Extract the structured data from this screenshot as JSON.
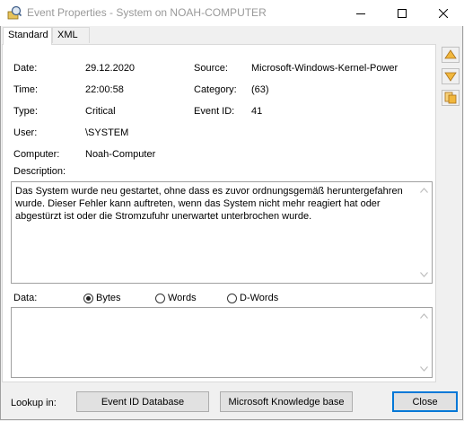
{
  "window": {
    "title": "Event Properties - System on NOAH-COMPUTER"
  },
  "tabs": [
    {
      "label": "Standard"
    },
    {
      "label": "XML"
    }
  ],
  "fields": {
    "date": {
      "label": "Date:",
      "value": "29.12.2020"
    },
    "time": {
      "label": "Time:",
      "value": "22:00:58"
    },
    "type": {
      "label": "Type:",
      "value": "Critical"
    },
    "user": {
      "label": "User:",
      "value": "\\SYSTEM"
    },
    "computer": {
      "label": "Computer:",
      "value": "Noah-Computer"
    },
    "source": {
      "label": "Source:",
      "value": "Microsoft-Windows-Kernel-Power"
    },
    "category": {
      "label": "Category:",
      "value": "(63)"
    },
    "event_id": {
      "label": "Event ID:",
      "value": "41"
    }
  },
  "description": {
    "label": "Description:",
    "text": "Das System wurde neu gestartet, ohne dass es zuvor ordnungsgemäß heruntergefahren wurde. Dieser Fehler kann auftreten, wenn das System nicht mehr reagiert hat oder abgestürzt ist oder die Stromzufuhr unerwartet unterbrochen wurde."
  },
  "data_section": {
    "label": "Data:",
    "options": [
      "Bytes",
      "Words",
      "D-Words"
    ],
    "selected": "Bytes",
    "content": ""
  },
  "footer": {
    "lookup_label": "Lookup in:",
    "event_id_db": "Event ID Database",
    "knowledge_base": "Microsoft Knowledge base",
    "close": "Close"
  },
  "icons": {
    "app": "event-viewer-icon",
    "side_buttons": [
      "arrow-up-icon",
      "arrow-down-icon",
      "copy-icon"
    ]
  },
  "colors": {
    "accent": "#0078d7",
    "side_icon": "#e8a93a"
  }
}
